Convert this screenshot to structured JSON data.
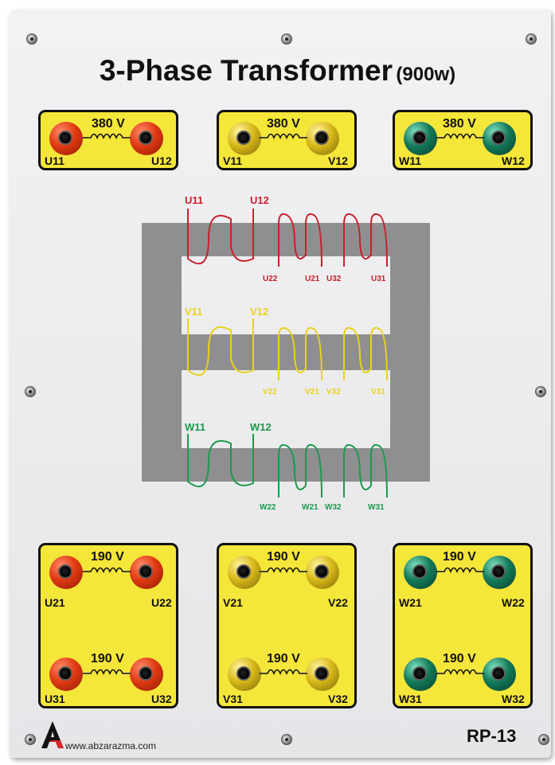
{
  "title": {
    "main": "3-Phase Transformer",
    "power": "(900w)"
  },
  "top_boxes": [
    {
      "voltage": "380 V",
      "left_label": "U11",
      "right_label": "U12",
      "color": "#e03a12"
    },
    {
      "voltage": "380 V",
      "left_label": "V11",
      "right_label": "V12",
      "color": "#d8b81a"
    },
    {
      "voltage": "380 V",
      "left_label": "W11",
      "right_label": "W12",
      "color": "#137a5a"
    }
  ],
  "bottom_boxes": [
    {
      "upper": {
        "voltage": "190 V",
        "left_label": "U21",
        "right_label": "U22"
      },
      "lower": {
        "voltage": "190 V",
        "left_label": "U31",
        "right_label": "U32"
      }
    },
    {
      "upper": {
        "voltage": "190 V",
        "left_label": "V21",
        "right_label": "V22"
      },
      "lower": {
        "voltage": "190 V",
        "left_label": "V31",
        "right_label": "V32"
      }
    },
    {
      "upper": {
        "voltage": "190 V",
        "left_label": "W21",
        "right_label": "W22"
      },
      "lower": {
        "voltage": "190 V",
        "left_label": "W31",
        "right_label": "W32"
      }
    }
  ],
  "diagram": {
    "u": {
      "primary": [
        "U11",
        "U12"
      ],
      "secondary": [
        "U22",
        "U21",
        "U32",
        "U31"
      ],
      "color": "#c8202a"
    },
    "v": {
      "primary": [
        "V11",
        "V12"
      ],
      "secondary": [
        "V22",
        "V21",
        "V32",
        "V31"
      ],
      "color": "#e8d21a"
    },
    "w": {
      "primary": [
        "W11",
        "W12"
      ],
      "secondary": [
        "W22",
        "W21",
        "W32",
        "W31"
      ],
      "color": "#1a9a4a"
    }
  },
  "footer": {
    "website": "www.abzarazma.com",
    "model": "RP-13"
  }
}
